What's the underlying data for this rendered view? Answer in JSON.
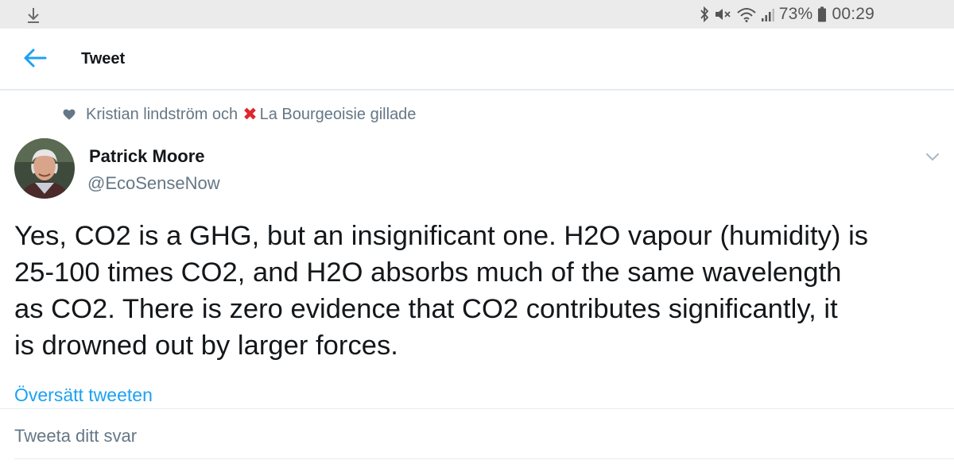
{
  "status_bar": {
    "battery_percent": "73%",
    "time": "00:29",
    "icons": [
      "download-icon",
      "bluetooth-icon",
      "mute-icon",
      "wifi-icon",
      "signal-icon",
      "battery-icon"
    ]
  },
  "app_bar": {
    "title": "Tweet",
    "back_icon": "arrow-left-icon"
  },
  "social_context": {
    "liker_1": "Kristian lindström och",
    "liker_2": "La Bourgeoisie gillade",
    "icon": "heart-icon",
    "emoji": "✖"
  },
  "tweet": {
    "author_name": "Patrick Moore",
    "author_handle": "@EcoSenseNow",
    "lines": [
      "Yes, CO2 is a GHG, but an insignificant one. H2O vapour (humidity) is",
      "25-100 times CO2, and H2O absorbs much of the same wavelength",
      "as CO2. There is zero evidence that CO2 contributes significantly, it",
      "is drowned out by larger forces."
    ],
    "translate_label": "Översätt tweeten"
  },
  "reply": {
    "placeholder": "Tweeta ditt svar"
  },
  "colors": {
    "accent": "#1da1f2",
    "secondary_text": "#657786",
    "primary_text": "#14171a",
    "status_bar_bg": "#ebebeb"
  }
}
